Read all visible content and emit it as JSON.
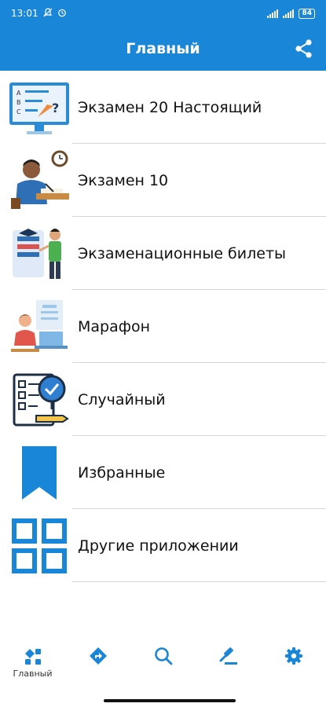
{
  "status_bar": {
    "time": "13:01",
    "battery": "84"
  },
  "app_bar": {
    "title": "Главный",
    "share_icon": "share-icon"
  },
  "menu": [
    {
      "label": "Экзамен 20 Настоящий",
      "icon": "exam-quiz-monitor-icon"
    },
    {
      "label": "Экзамен 10",
      "icon": "student-writing-icon"
    },
    {
      "label": "Экзаменационные билеты",
      "icon": "tickets-teacher-icon"
    },
    {
      "label": "Марафон",
      "icon": "marathon-laptop-icon"
    },
    {
      "label": "Случайный",
      "icon": "random-checklist-icon"
    },
    {
      "label": "Избранные",
      "icon": "bookmark-icon"
    },
    {
      "label": "Другие приложении",
      "icon": "apps-grid-icon"
    }
  ],
  "bottom_nav": {
    "home_label": "Главный",
    "items": [
      "home-icon",
      "directions-icon",
      "search-icon",
      "gavel-icon",
      "settings-icon"
    ]
  },
  "colors": {
    "primary": "#1a86d8",
    "text": "#111111",
    "divider": "#d6d6d6"
  }
}
